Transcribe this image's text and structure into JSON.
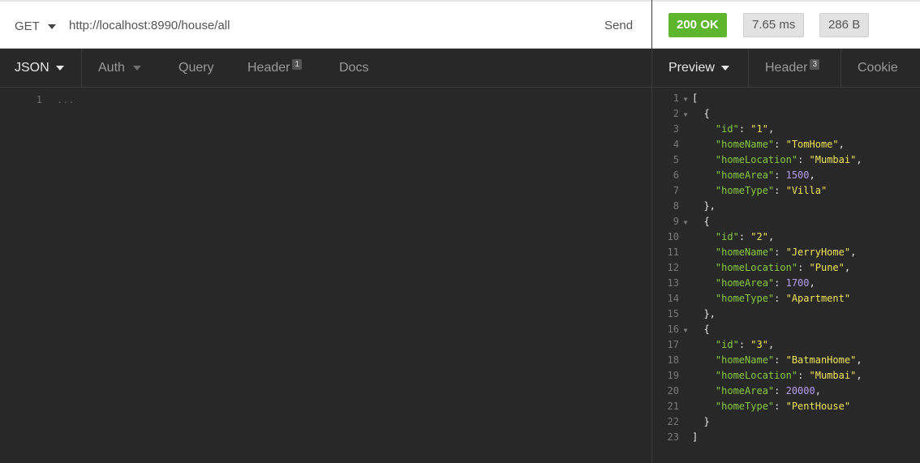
{
  "request": {
    "method": "GET",
    "url": "http://localhost:8990/house/all",
    "send_label": "Send",
    "tabs": {
      "body": "JSON",
      "auth": "Auth",
      "query": "Query",
      "header": "Header",
      "header_count": "1",
      "docs": "Docs"
    },
    "editor": {
      "line_number": "1",
      "content": "..."
    }
  },
  "response": {
    "status": "200 OK",
    "time": "7.65 ms",
    "size": "286 B",
    "tabs": {
      "preview": "Preview",
      "header": "Header",
      "header_count": "3",
      "cookie": "Cookie"
    },
    "lines": [
      {
        "ln": "1",
        "fold": true,
        "indent": "",
        "type": "punct",
        "text": "["
      },
      {
        "ln": "2",
        "fold": true,
        "indent": "  ",
        "type": "punct",
        "text": "{"
      },
      {
        "ln": "3",
        "indent": "    ",
        "type": "kv",
        "key": "\"id\"",
        "value": "\"1\"",
        "vtype": "s",
        "comma": ","
      },
      {
        "ln": "4",
        "indent": "    ",
        "type": "kv",
        "key": "\"homeName\"",
        "value": "\"TomHome\"",
        "vtype": "s",
        "comma": ","
      },
      {
        "ln": "5",
        "indent": "    ",
        "type": "kv",
        "key": "\"homeLocation\"",
        "value": "\"Mumbai\"",
        "vtype": "s",
        "comma": ","
      },
      {
        "ln": "6",
        "indent": "    ",
        "type": "kv",
        "key": "\"homeArea\"",
        "value": "1500",
        "vtype": "n",
        "comma": ","
      },
      {
        "ln": "7",
        "indent": "    ",
        "type": "kv",
        "key": "\"homeType\"",
        "value": "\"Villa\"",
        "vtype": "s",
        "comma": ""
      },
      {
        "ln": "8",
        "indent": "  ",
        "type": "punct",
        "text": "},"
      },
      {
        "ln": "9",
        "fold": true,
        "indent": "  ",
        "type": "punct",
        "text": "{"
      },
      {
        "ln": "10",
        "indent": "    ",
        "type": "kv",
        "key": "\"id\"",
        "value": "\"2\"",
        "vtype": "s",
        "comma": ","
      },
      {
        "ln": "11",
        "indent": "    ",
        "type": "kv",
        "key": "\"homeName\"",
        "value": "\"JerryHome\"",
        "vtype": "s",
        "comma": ","
      },
      {
        "ln": "12",
        "indent": "    ",
        "type": "kv",
        "key": "\"homeLocation\"",
        "value": "\"Pune\"",
        "vtype": "s",
        "comma": ","
      },
      {
        "ln": "13",
        "indent": "    ",
        "type": "kv",
        "key": "\"homeArea\"",
        "value": "1700",
        "vtype": "n",
        "comma": ","
      },
      {
        "ln": "14",
        "indent": "    ",
        "type": "kv",
        "key": "\"homeType\"",
        "value": "\"Apartment\"",
        "vtype": "s",
        "comma": ""
      },
      {
        "ln": "15",
        "indent": "  ",
        "type": "punct",
        "text": "},"
      },
      {
        "ln": "16",
        "fold": true,
        "indent": "  ",
        "type": "punct",
        "text": "{"
      },
      {
        "ln": "17",
        "indent": "    ",
        "type": "kv",
        "key": "\"id\"",
        "value": "\"3\"",
        "vtype": "s",
        "comma": ","
      },
      {
        "ln": "18",
        "indent": "    ",
        "type": "kv",
        "key": "\"homeName\"",
        "value": "\"BatmanHome\"",
        "vtype": "s",
        "comma": ","
      },
      {
        "ln": "19",
        "indent": "    ",
        "type": "kv",
        "key": "\"homeLocation\"",
        "value": "\"Mumbai\"",
        "vtype": "s",
        "comma": ","
      },
      {
        "ln": "20",
        "indent": "    ",
        "type": "kv",
        "key": "\"homeArea\"",
        "value": "20000",
        "vtype": "n",
        "comma": ","
      },
      {
        "ln": "21",
        "indent": "    ",
        "type": "kv",
        "key": "\"homeType\"",
        "value": "\"PentHouse\"",
        "vtype": "s",
        "comma": ""
      },
      {
        "ln": "22",
        "indent": "  ",
        "type": "punct",
        "text": "}"
      },
      {
        "ln": "23",
        "indent": "",
        "type": "punct",
        "text": "]"
      }
    ]
  },
  "colors": {
    "status_ok": "#5db62e",
    "json_key": "#87c940",
    "json_string": "#f0e65a",
    "json_number": "#b39ef0",
    "background": "#282828"
  }
}
